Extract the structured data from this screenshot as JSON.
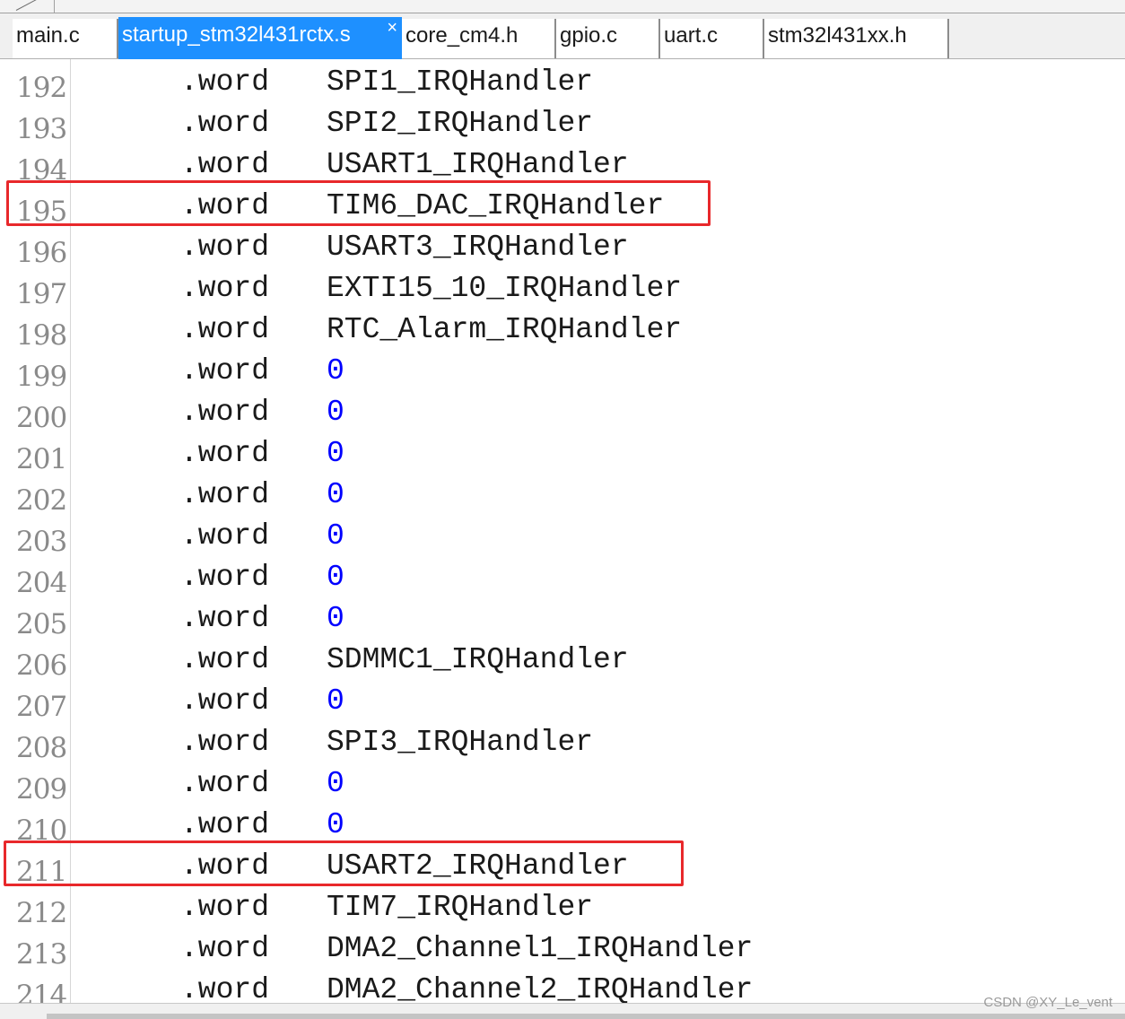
{
  "tabs": [
    {
      "label": "main.c",
      "active": false
    },
    {
      "label": "startup_stm32l431rctx.s",
      "active": true,
      "close_glyph": "×"
    },
    {
      "label": "core_cm4.h",
      "active": false
    },
    {
      "label": "gpio.c",
      "active": false
    },
    {
      "label": "uart.c",
      "active": false
    },
    {
      "label": "stm32l431xx.h",
      "active": false
    }
  ],
  "editor": {
    "lines": [
      {
        "no": "192",
        "directive": ".word",
        "operand": "SPI1_IRQHandler",
        "kind": "symbol"
      },
      {
        "no": "193",
        "directive": ".word",
        "operand": "SPI2_IRQHandler",
        "kind": "symbol"
      },
      {
        "no": "194",
        "directive": ".word",
        "operand": "USART1_IRQHandler",
        "kind": "symbol"
      },
      {
        "no": "195",
        "directive": ".word",
        "operand": "TIM6_DAC_IRQHandler",
        "kind": "symbol",
        "highlighted": true
      },
      {
        "no": "196",
        "directive": ".word",
        "operand": "USART3_IRQHandler",
        "kind": "symbol"
      },
      {
        "no": "197",
        "directive": ".word",
        "operand": "EXTI15_10_IRQHandler",
        "kind": "symbol"
      },
      {
        "no": "198",
        "directive": ".word",
        "operand": "RTC_Alarm_IRQHandler",
        "kind": "symbol"
      },
      {
        "no": "199",
        "directive": ".word",
        "operand": "0",
        "kind": "number"
      },
      {
        "no": "200",
        "directive": ".word",
        "operand": "0",
        "kind": "number"
      },
      {
        "no": "201",
        "directive": ".word",
        "operand": "0",
        "kind": "number"
      },
      {
        "no": "202",
        "directive": ".word",
        "operand": "0",
        "kind": "number"
      },
      {
        "no": "203",
        "directive": ".word",
        "operand": "0",
        "kind": "number"
      },
      {
        "no": "204",
        "directive": ".word",
        "operand": "0",
        "kind": "number"
      },
      {
        "no": "205",
        "directive": ".word",
        "operand": "0",
        "kind": "number"
      },
      {
        "no": "206",
        "directive": ".word",
        "operand": "SDMMC1_IRQHandler",
        "kind": "symbol"
      },
      {
        "no": "207",
        "directive": ".word",
        "operand": "0",
        "kind": "number"
      },
      {
        "no": "208",
        "directive": ".word",
        "operand": "SPI3_IRQHandler",
        "kind": "symbol"
      },
      {
        "no": "209",
        "directive": ".word",
        "operand": "0",
        "kind": "number"
      },
      {
        "no": "210",
        "directive": ".word",
        "operand": "0",
        "kind": "number"
      },
      {
        "no": "211",
        "directive": ".word",
        "operand": "USART2_IRQHandler",
        "kind": "symbol",
        "highlighted": true
      },
      {
        "no": "212",
        "directive": ".word",
        "operand": "TIM7_IRQHandler",
        "kind": "symbol"
      },
      {
        "no": "213",
        "directive": ".word",
        "operand": "DMA2_Channel1_IRQHandler",
        "kind": "symbol"
      },
      {
        "no": "214",
        "directive": ".word",
        "operand": "DMA2_Channel2_IRQHandler",
        "kind": "symbol"
      }
    ]
  },
  "colors": {
    "active_tab": "#1e90ff",
    "number_literal": "#0000ff",
    "highlight_box": "#e8282b",
    "line_number": "#8a8a8a"
  },
  "watermark": "CSDN @XY_Le_vent"
}
